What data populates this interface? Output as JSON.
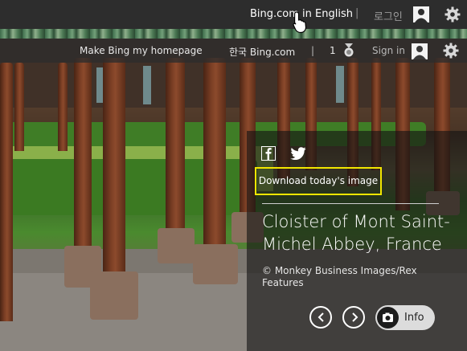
{
  "topbar": {
    "bing_english_link": "Bing.com in English",
    "separator": "|",
    "login_label": "로그인"
  },
  "header2": {
    "homepage_link": "Make Bing my homepage",
    "korea_link": "한국 Bing.com",
    "separator": "|",
    "rewards_count": "1",
    "signin_label": "Sign in"
  },
  "overlay": {
    "download_label": "Download today's image",
    "title": "Cloister of Mont Saint-Michel Abbey, France",
    "credit": "© Monkey Business Images/Rex Features",
    "info_label": "Info"
  },
  "colors": {
    "highlight_border": "#f2e600",
    "topbar_bg": "#2d2d2d"
  }
}
